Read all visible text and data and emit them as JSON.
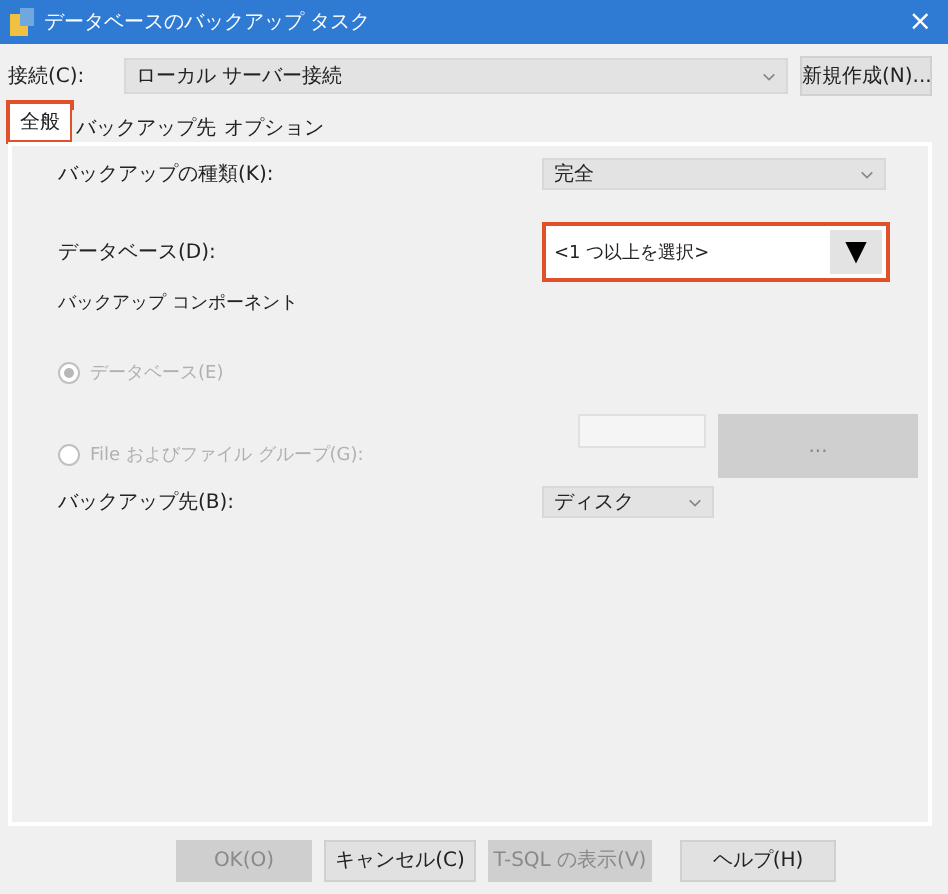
{
  "window": {
    "title": "データベースのバックアップ タスク",
    "close": "×"
  },
  "connection": {
    "label": "接続(C):",
    "value": "ローカル サーバー接続",
    "new_button": "新規作成(N)..."
  },
  "tabs": [
    {
      "label": "全般",
      "selected": true,
      "highlighted": true
    },
    {
      "label": "バックアップ先",
      "selected": false,
      "highlighted": false
    },
    {
      "label": "オプション",
      "selected": false,
      "highlighted": false
    }
  ],
  "backup_type": {
    "label": "バックアップの種類(K):",
    "value": "完全"
  },
  "database": {
    "label": "データベース(D):",
    "value": "<1 つ以上を選択>",
    "arrow": "▼",
    "highlighted": true
  },
  "components": {
    "label": "バックアップ コンポーネント",
    "options": [
      {
        "label": "データベース(E)",
        "selected": true,
        "disabled": true
      },
      {
        "label": "File およびファイル グループ(G):",
        "selected": false,
        "disabled": true
      }
    ],
    "browse_button": "..."
  },
  "destination": {
    "label": "バックアップ先(B):",
    "value": "ディスク"
  },
  "buttons": [
    {
      "label": "OK(O)",
      "disabled": true
    },
    {
      "label": "キャンセル(C)",
      "disabled": false
    },
    {
      "label": "T-SQL の表示(V)",
      "disabled": true
    },
    {
      "label": "ヘルプ(H)",
      "disabled": false
    }
  ]
}
